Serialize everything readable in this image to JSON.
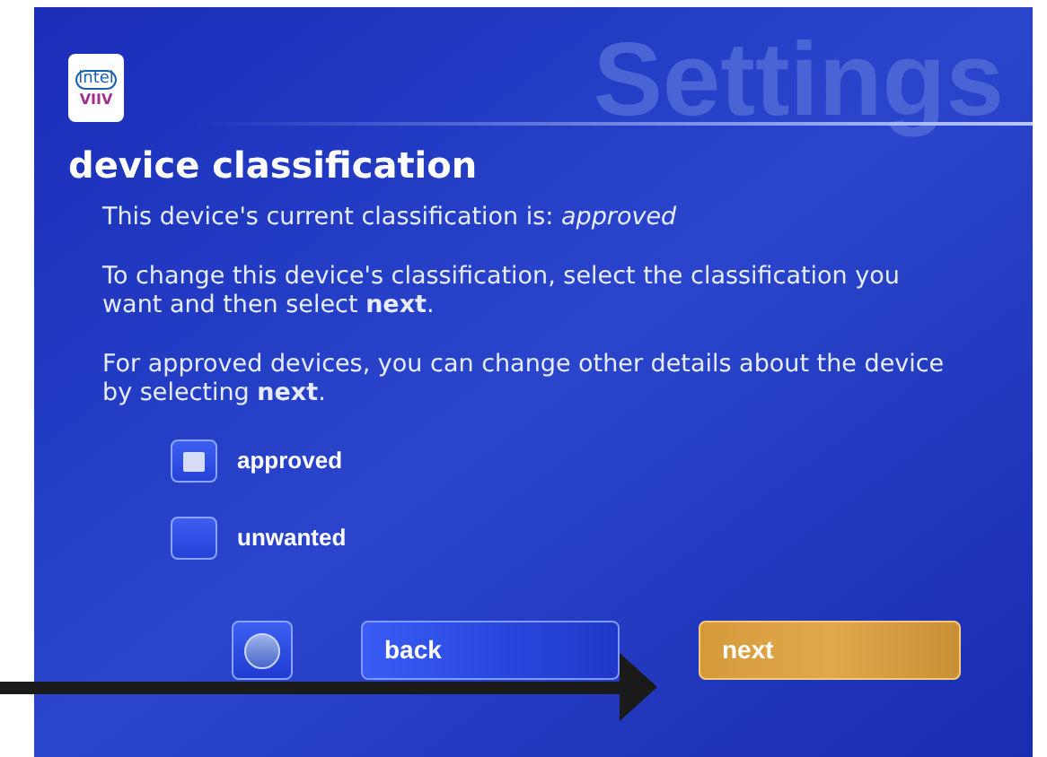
{
  "header": {
    "logo_top": "intel",
    "logo_bottom": "VIIV",
    "watermark": "Settings"
  },
  "title": "device classification",
  "paragraphs": [
    "This device's current classification is: *approved*",
    "To change this device's classification, select the classification you want and then select **next**.",
    "For approved devices, you can change other details about the device by selecting **next**."
  ],
  "options": [
    {
      "label": "approved",
      "selected": true
    },
    {
      "label": "unwanted",
      "selected": false
    }
  ],
  "buttons": [
    {
      "kind": "help"
    },
    {
      "kind": "back",
      "label": "back"
    },
    {
      "kind": "next",
      "label": "next"
    }
  ]
}
